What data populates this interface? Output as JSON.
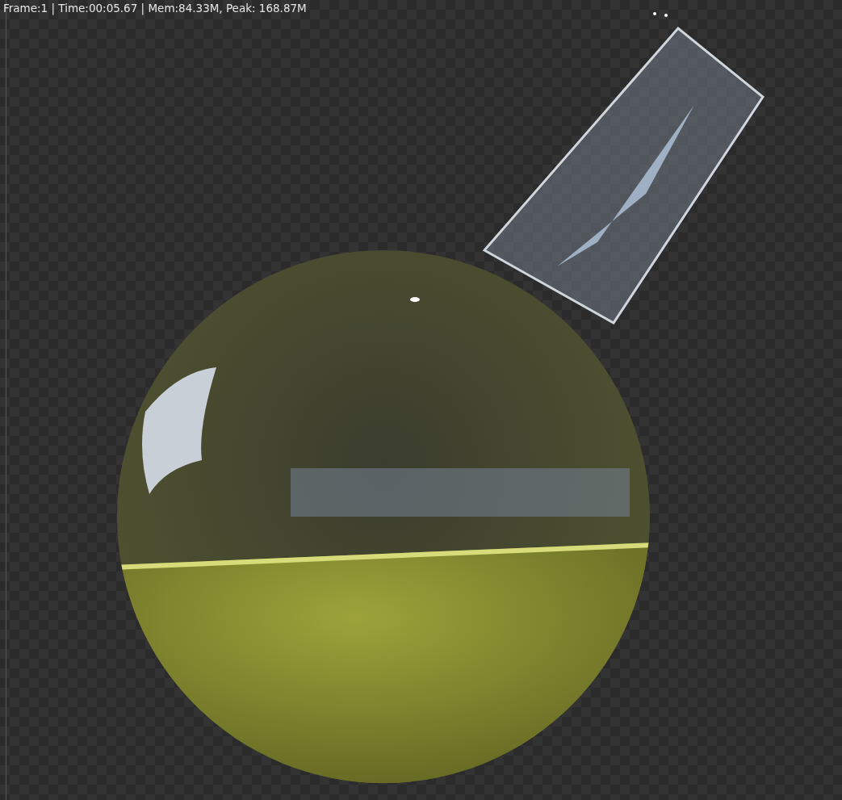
{
  "viewer": {
    "stats": "Frame:1 | Time:00:05.67 | Mem:84.33M, Peak: 168.87M"
  }
}
